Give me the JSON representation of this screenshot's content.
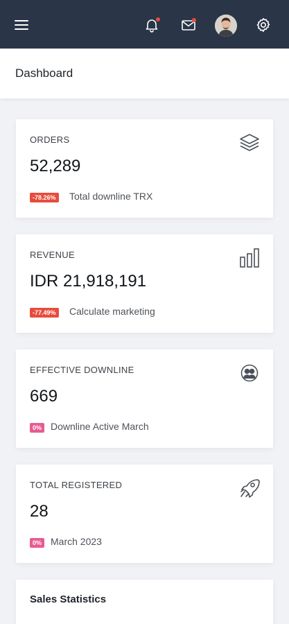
{
  "topbar": {
    "background": "#2a3547",
    "notification_dot_color": "#e74c3c",
    "icons": [
      "menu-icon",
      "bell-icon",
      "mail-icon",
      "avatar",
      "gear-icon"
    ]
  },
  "page": {
    "title": "Dashboard"
  },
  "cards": [
    {
      "label": "ORDERS",
      "value": "52,289",
      "badge": "-78.26%",
      "badge_color": "#e74c3c",
      "description": "Total downline TRX",
      "icon": "layers-icon"
    },
    {
      "label": "REVENUE",
      "value": "IDR 21,918,191",
      "badge": "-77.49%",
      "badge_color": "#e74c3c",
      "description": "Calculate marketing",
      "icon": "bar-chart-icon"
    },
    {
      "label": "EFFECTIVE DOWNLINE",
      "value": "669",
      "badge": "0%",
      "badge_color": "#ea5a92",
      "description": "Downline Active March",
      "icon": "users-icon"
    },
    {
      "label": "TOTAL REGISTERED",
      "value": "28",
      "badge": "0%",
      "badge_color": "#ea5a92",
      "description": "March 2023",
      "icon": "rocket-icon"
    }
  ],
  "sales": {
    "title": "Sales Statistics"
  }
}
